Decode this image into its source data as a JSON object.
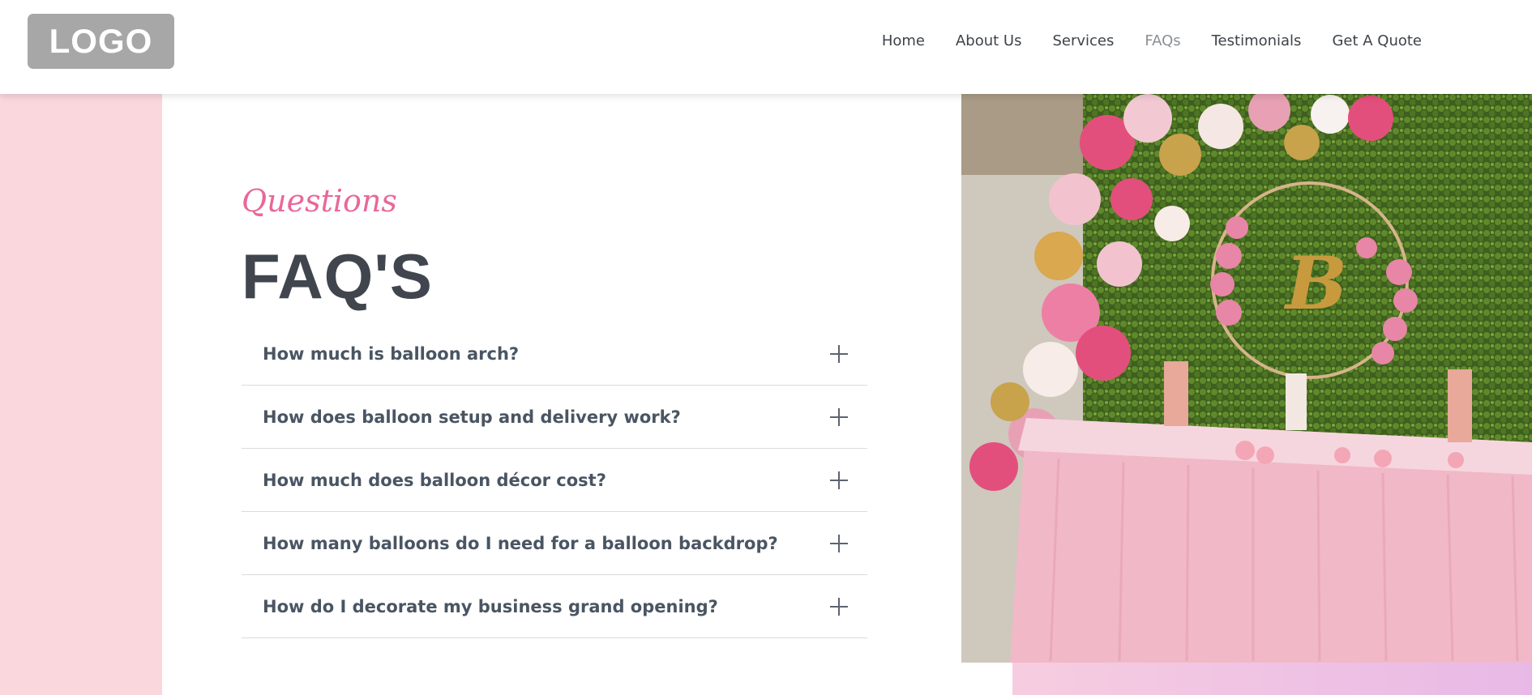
{
  "header": {
    "logo_text": "LOGO",
    "nav": [
      "Home",
      "About Us",
      "Services",
      "FAQs",
      "Testimonials",
      "Get A Quote"
    ],
    "active_nav": "FAQs"
  },
  "section": {
    "eyebrow": "Questions",
    "title": "FAQ'S"
  },
  "faqs": [
    "How much is balloon arch?",
    "How does balloon setup and delivery work?",
    "How much does balloon décor cost?",
    "How many balloons do I need for a balloon backdrop?",
    "How do I decorate my business grand opening?"
  ],
  "colors": {
    "accent_pink": "#e9679a",
    "strip_pink": "#fad6dd",
    "heading": "#41464e",
    "question": "#4a5563"
  }
}
